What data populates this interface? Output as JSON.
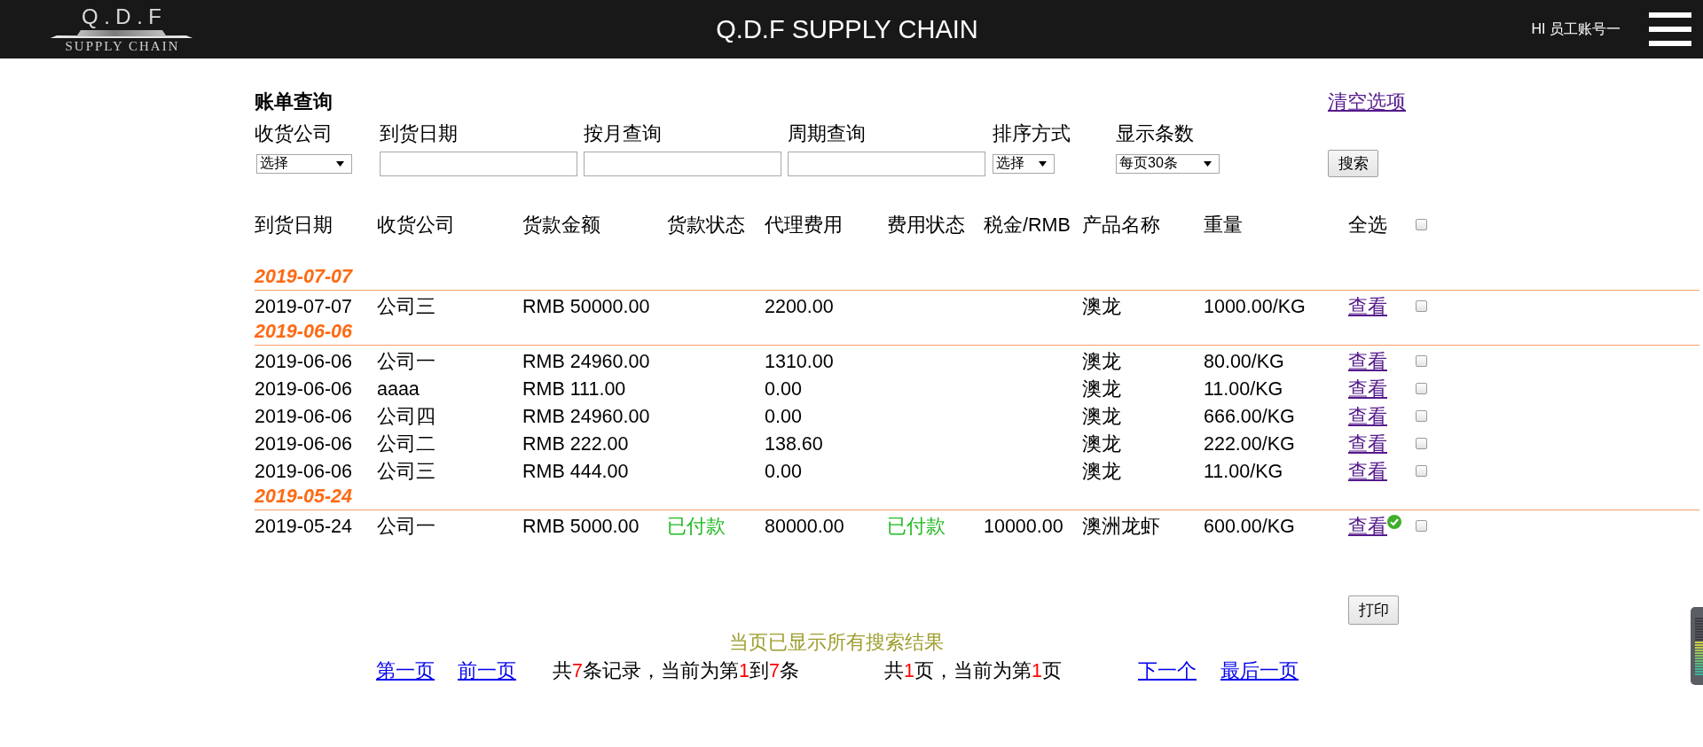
{
  "header": {
    "logo": {
      "title": "Q.D.F",
      "tagline": "SUPPLY CHAIN"
    },
    "title": "Q.D.F SUPPLY CHAIN",
    "user": "HI 员工账号一"
  },
  "query": {
    "title": "账单查询",
    "clear_link": {
      "text": "清空选项",
      "visited": true
    },
    "filters": [
      {
        "label": "收货公司",
        "kind": "select",
        "value": "选择"
      },
      {
        "label": "到货日期",
        "kind": "input"
      },
      {
        "label": "按月查询",
        "kind": "input"
      },
      {
        "label": "周期查询",
        "kind": "input"
      },
      {
        "label": "排序方式",
        "kind": "select",
        "value": "选择"
      },
      {
        "label": "显示条数",
        "kind": "select",
        "value": "每页30条"
      }
    ],
    "search_button": "搜索"
  },
  "table": {
    "columns": [
      "到货日期",
      "收货公司",
      "货款金额",
      "货款状态",
      "代理费用",
      "费用状态",
      "税金/RMB",
      "产品名称",
      "重量",
      "全选"
    ],
    "select_all_checked": false,
    "groups": [
      {
        "date": "2019-07-07",
        "rows": [
          {
            "date": "2019-07-07",
            "company": "公司三",
            "amount": "RMB 50000.00",
            "fee": "2200.00",
            "product": "澳龙",
            "weight": "1000.00/KG",
            "link": "查看",
            "link_visited": true,
            "verified": false,
            "checked": false
          }
        ]
      },
      {
        "date": "2019-06-06",
        "rows": [
          {
            "date": "2019-06-06",
            "company": "公司一",
            "amount": "RMB 24960.00",
            "fee": "1310.00",
            "product": "澳龙",
            "weight": "80.00/KG",
            "link": "查看",
            "link_visited": true,
            "verified": false,
            "checked": false
          },
          {
            "date": "2019-06-06",
            "company": "aaaa",
            "amount": "RMB 111.00",
            "fee": "0.00",
            "product": "澳龙",
            "weight": "11.00/KG",
            "link": "查看",
            "link_visited": true,
            "verified": false,
            "checked": false
          },
          {
            "date": "2019-06-06",
            "company": "公司四",
            "amount": "RMB 24960.00",
            "fee": "0.00",
            "product": "澳龙",
            "weight": "666.00/KG",
            "link": "查看",
            "link_visited": true,
            "verified": false,
            "checked": false
          },
          {
            "date": "2019-06-06",
            "company": "公司二",
            "amount": "RMB 222.00",
            "fee": "138.60",
            "product": "澳龙",
            "weight": "222.00/KG",
            "link": "查看",
            "link_visited": true,
            "verified": false,
            "checked": false
          },
          {
            "date": "2019-06-06",
            "company": "公司三",
            "amount": "RMB 444.00",
            "fee": "0.00",
            "product": "澳龙",
            "weight": "11.00/KG",
            "link": "查看",
            "link_visited": true,
            "verified": false,
            "checked": false
          }
        ]
      },
      {
        "date": "2019-05-24",
        "rows": [
          {
            "date": "2019-05-24",
            "company": "公司一",
            "amount": "RMB 5000.00",
            "payment_status": "已付款",
            "fee": "80000.00",
            "fee_status": "已付款",
            "tax": "10000.00",
            "product": "澳洲龙虾",
            "weight": "600.00/KG",
            "link": "查看",
            "link_visited": true,
            "verified": true,
            "checked": false
          }
        ]
      }
    ]
  },
  "footer": {
    "print_button": "打印",
    "message": "当页已显示所有搜索结果",
    "pagination": [
      {
        "kind": "link",
        "text": "第一页",
        "visited": false
      },
      {
        "kind": "link",
        "text": "前一页",
        "visited": false
      },
      {
        "kind": "summary",
        "parts": [
          {
            "text": "共",
            "highlight": false
          },
          {
            "text": "7",
            "highlight": true
          },
          {
            "text": "条记录，当前为第",
            "highlight": false
          },
          {
            "text": "1",
            "highlight": true
          },
          {
            "text": "到",
            "highlight": false
          },
          {
            "text": "7",
            "highlight": true
          },
          {
            "text": "条",
            "highlight": false
          }
        ]
      },
      {
        "kind": "summary",
        "parts": [
          {
            "text": "共",
            "highlight": false
          },
          {
            "text": "1",
            "highlight": true
          },
          {
            "text": "页，当前为第",
            "highlight": false
          },
          {
            "text": "1",
            "highlight": true
          },
          {
            "text": "页",
            "highlight": false
          }
        ]
      },
      {
        "kind": "link",
        "text": "下一个",
        "visited": false
      },
      {
        "kind": "link",
        "text": "最后一页",
        "visited": false
      }
    ]
  }
}
